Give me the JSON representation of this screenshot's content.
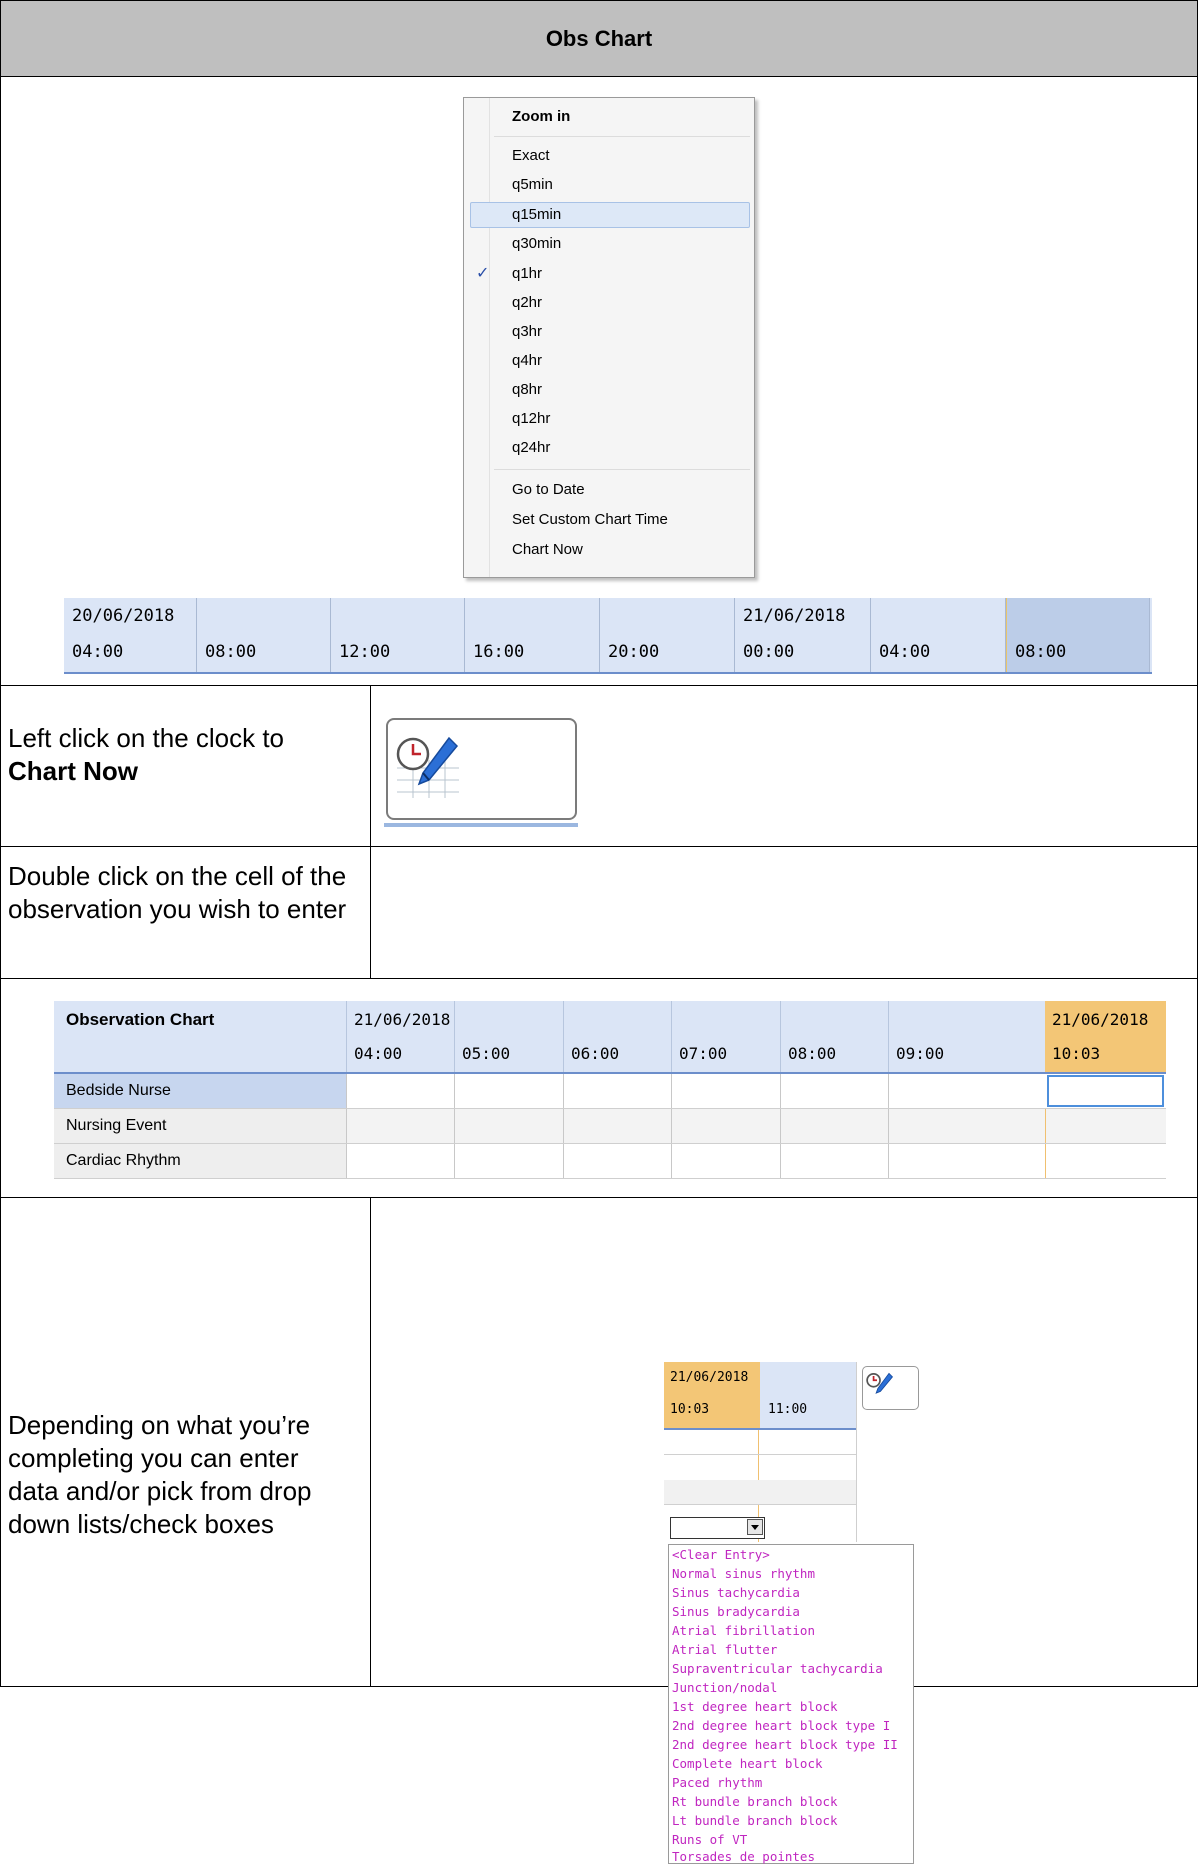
{
  "header": {
    "title": "Obs Chart"
  },
  "menu": {
    "title": "Zoom in",
    "items": [
      "Exact",
      "q5min",
      "q15min",
      "q30min",
      "q1hr",
      "q2hr",
      "q3hr",
      "q4hr",
      "q8hr",
      "q12hr",
      "q24hr"
    ],
    "highlighted": "q15min",
    "checked": "q1hr",
    "check_glyph": "✓",
    "actions": [
      "Go to Date",
      "Set Custom Chart Time",
      "Chart Now"
    ]
  },
  "timeline": {
    "dates": {
      "first": "20/06/2018",
      "second": "21/06/2018"
    },
    "times": [
      "04:00",
      "08:00",
      "12:00",
      "16:00",
      "20:00",
      "00:00",
      "04:00",
      "08:00"
    ]
  },
  "instructions": {
    "chart_now_prefix": "Left click on the clock to",
    "chart_now_bold": "Chart Now",
    "double_click": "Double click on the cell of the observation you wish to enter",
    "depending": "Depending on what you’re completing you can enter data and/or pick from drop down lists/check boxes"
  },
  "observation_chart": {
    "title": "Observation Chart",
    "date": "21/06/2018",
    "times": [
      "04:00",
      "05:00",
      "06:00",
      "07:00",
      "08:00",
      "09:00"
    ],
    "current": {
      "date": "21/06/2018",
      "time": "10:03"
    },
    "rows": [
      "Bedside Nurse",
      "Nursing Event",
      "Cardiac Rhythm"
    ]
  },
  "dropdown_example": {
    "current": {
      "date": "21/06/2018",
      "time": "10:03"
    },
    "next_time": "11:00",
    "options": [
      "<Clear Entry>",
      "Normal sinus rhythm",
      "Sinus tachycardia",
      "Sinus bradycardia",
      "Atrial fibrillation",
      "Atrial flutter",
      "Supraventricular tachycardia",
      "Junction/nodal",
      "1st degree heart block",
      "2nd degree heart block type I",
      "2nd degree heart block type II",
      "Complete heart block",
      "Paced rhythm",
      "Rt bundle branch block",
      "Lt bundle branch block",
      "Runs of VT",
      "Torsades de pointes"
    ]
  },
  "icons": {
    "clock": "clock-pencil-icon",
    "dropdown_arrow": "dropdown-arrow-icon"
  }
}
